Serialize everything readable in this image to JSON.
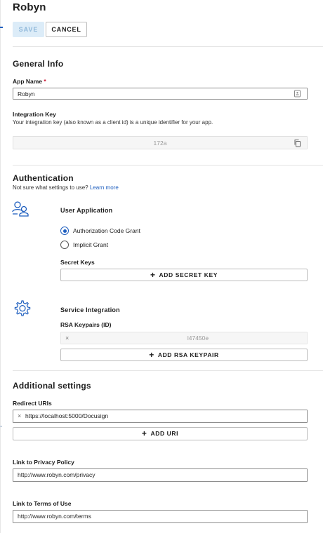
{
  "header": {
    "title": "Robyn",
    "save_label": "SAVE",
    "cancel_label": "CANCEL"
  },
  "general": {
    "title": "General Info",
    "app_name_label": "App Name",
    "required_mark": "*",
    "app_name_value": "Robyn",
    "integration_key_label": "Integration Key",
    "integration_key_help": "Your integration key (also known as a client id) is a unique identifier for your app.",
    "integration_key_value": "172a"
  },
  "auth": {
    "title": "Authentication",
    "help": "Not sure what settings to use?",
    "learn_more": "Learn more",
    "user_app_title": "User Application",
    "grants": [
      {
        "label": "Authorization Code Grant",
        "selected": true
      },
      {
        "label": "Implicit Grant",
        "selected": false
      }
    ],
    "secret_keys_label": "Secret Keys",
    "add_secret_key": "ADD SECRET KEY",
    "service_title": "Service Integration",
    "rsa_label": "RSA Keypairs (ID)",
    "rsa_value": "l47450e",
    "add_rsa": "ADD RSA KEYPAIR"
  },
  "additional": {
    "title": "Additional settings",
    "redirect_label": "Redirect URIs",
    "redirect_value": "https://localhost:5000/Docusign",
    "add_uri": "ADD URI",
    "privacy_label": "Link to Privacy Policy",
    "privacy_value": "http://www.robyn.com/privacy",
    "terms_label": "Link to Terms of Use",
    "terms_value": "http://www.robyn.com/terms"
  },
  "colors": {
    "accent": "#1f5fbf",
    "required": "#c8102e",
    "save_bg": "#dcecf8"
  },
  "icons": [
    "users-icon",
    "gear-icon",
    "copy-icon",
    "contact-card-icon",
    "close-icon",
    "plus-icon"
  ]
}
